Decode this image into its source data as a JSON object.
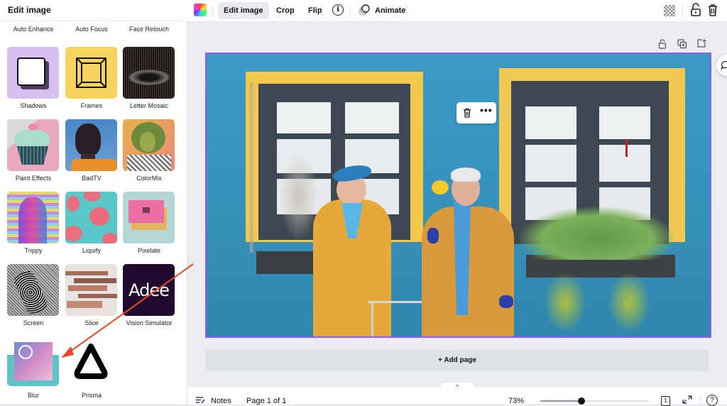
{
  "sidebar": {
    "title": "Edit image",
    "top_row_labels": [
      "Auto Enhance",
      "Auto Focus",
      "Face Retouch"
    ],
    "effects": [
      {
        "label": "Shadows",
        "icon": "shadow-icon"
      },
      {
        "label": "Frames",
        "icon": "frame-icon"
      },
      {
        "label": "Letter Mosaic",
        "icon": "letter-mosaic-thumbnail"
      },
      {
        "label": "Paint Effects",
        "icon": "paint-effects-thumbnail"
      },
      {
        "label": "BadTV",
        "icon": "badtv-thumbnail"
      },
      {
        "label": "ColorMix",
        "icon": "colormix-thumbnail"
      },
      {
        "label": "Trippy",
        "icon": "trippy-thumbnail"
      },
      {
        "label": "Liquify",
        "icon": "liquify-thumbnail"
      },
      {
        "label": "Pixelate",
        "icon": "pixelate-thumbnail"
      },
      {
        "label": "Screen",
        "icon": "screen-thumbnail"
      },
      {
        "label": "Slice",
        "icon": "slice-thumbnail"
      },
      {
        "label": "Vision Simulator",
        "icon": "vision-simulator-thumbnail",
        "logo_text": "Adee"
      },
      {
        "label": "Blur",
        "icon": "blur-thumbnail"
      },
      {
        "label": "Prisma",
        "icon": "prisma-icon"
      }
    ]
  },
  "toolbar": {
    "edit_image": "Edit image",
    "crop": "Crop",
    "flip": "Flip",
    "animate": "Animate"
  },
  "canvas": {
    "add_page": "+ Add page",
    "selection_color": "#8b5cf6"
  },
  "bottombar": {
    "notes": "Notes",
    "page_indicator": "Page 1 of 1",
    "zoom": "73%",
    "zoom_fraction": 0.38,
    "page_count": "1"
  },
  "annotation": {
    "arrow_color": "#e2492f",
    "target": "Blur"
  }
}
